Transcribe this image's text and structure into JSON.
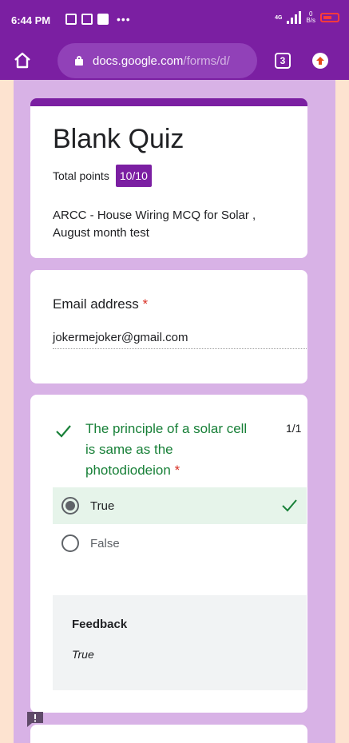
{
  "status_bar": {
    "time": "6:44 PM",
    "dots": "•••",
    "network_label": "4G",
    "speed_value": "0",
    "speed_unit": "B/s",
    "battery_color": "#ff3b3b"
  },
  "browser": {
    "url_domain": "docs.google.com",
    "url_path": "/forms/d/",
    "tab_count": "3",
    "toolbar_color": "#7b1fa2"
  },
  "header_card": {
    "title": "Blank Quiz",
    "points_label": "Total points",
    "points_value": "10/10",
    "description": "ARCC - House Wiring MCQ for Solar , August month test"
  },
  "email_card": {
    "label": "Email address",
    "required_mark": "*",
    "value": "jokermejoker@gmail.com"
  },
  "question_card": {
    "question": "The principle of a solar cell is same as the photodiodeion",
    "required_mark": "*",
    "score": "1/1",
    "options": [
      {
        "label": "True",
        "selected": true,
        "correct": true
      },
      {
        "label": "False",
        "selected": false,
        "correct": false
      }
    ],
    "feedback_title": "Feedback",
    "feedback_value": "True",
    "correct_color": "#188038"
  },
  "icons": {
    "home": "home-icon",
    "lock": "lock-icon",
    "tabs": "tabs-icon",
    "update": "update-icon",
    "check": "check-icon",
    "report": "report-problem-icon"
  }
}
